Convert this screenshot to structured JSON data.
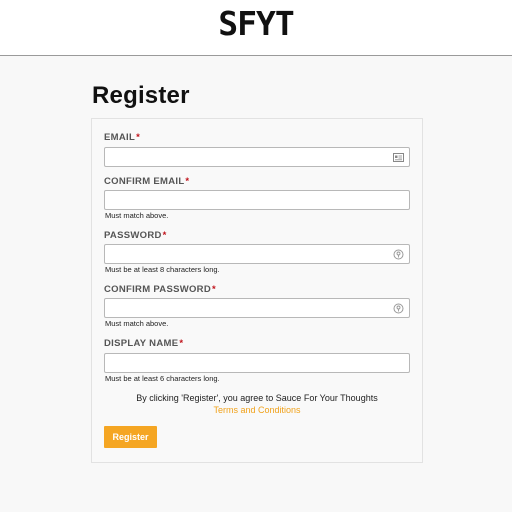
{
  "header": {
    "logo_text": "SFYT"
  },
  "page": {
    "title": "Register"
  },
  "form": {
    "required_marker": "*",
    "email": {
      "label": "EMAIL",
      "value": "",
      "icon": "contact-card-icon"
    },
    "confirm_email": {
      "label": "CONFIRM EMAIL",
      "value": "",
      "hint": "Must match above."
    },
    "password": {
      "label": "PASSWORD",
      "value": "",
      "hint": "Must be at least 8 characters long.",
      "icon": "password-key-icon"
    },
    "confirm_password": {
      "label": "CONFIRM PASSWORD",
      "value": "",
      "hint": "Must match above.",
      "icon": "password-key-icon"
    },
    "display_name": {
      "label": "DISPLAY NAME",
      "value": "",
      "hint": "Must be at least 6 characters long."
    },
    "agreement_text": "By clicking 'Register', you agree to Sauce For Your Thoughts",
    "terms_link": "Terms and Conditions",
    "submit_label": "Register"
  },
  "colors": {
    "accent": "#f5a623",
    "link": "#f0a21b",
    "required": "#c0141c"
  }
}
